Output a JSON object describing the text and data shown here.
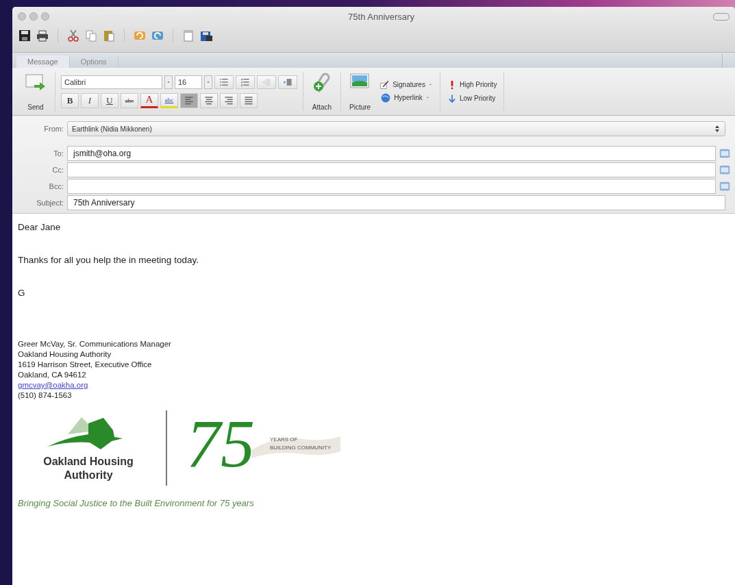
{
  "window": {
    "title": "75th Anniversary"
  },
  "tabs": [
    {
      "label": "Message",
      "selected": true
    },
    {
      "label": "Options",
      "selected": false
    }
  ],
  "ribbon": {
    "send": "Send",
    "font": "Calibri",
    "size": "16",
    "bold": "B",
    "italic": "I",
    "underline": "U",
    "strike": "abc",
    "font_color": "A",
    "highlight": "abc",
    "alignment": [
      {
        "selected": true
      },
      {
        "selected": false
      },
      {
        "selected": false
      },
      {
        "selected": false
      }
    ],
    "attach": "Attach",
    "picture": "Picture",
    "signatures": "Signatures",
    "hyperlink": "Hyperlink",
    "high_priority": "High Priority",
    "low_priority": "Low Priority"
  },
  "header": {
    "from_label": "From:",
    "from": "Earthlink (Nidia Mikkonen)",
    "fields": [
      {
        "label": "To:",
        "value": "jsmith@oha.org"
      },
      {
        "label": "Cc:"
      },
      {
        "label": "Bcc:"
      },
      {
        "label": "Subject:",
        "value": "75th Anniversary",
        "kind": "subject"
      }
    ]
  },
  "body": {
    "paragraphs": [
      "Dear Jane",
      "Thanks for all you help the in meeting today.",
      "G"
    ],
    "signature": [
      "Greer McVay, Sr. Communications Manager",
      "Oakland Housing Authority",
      "1619 Harrison Street, Executive Office",
      "Oakland, CA 94612"
    ],
    "email_link": "gmcvay@oakha.org",
    "phone": "(510) 874-1563",
    "logo": {
      "name_line_1": "Oakland Housing",
      "name_line_2": "Authority",
      "number": "75",
      "ribbon_1": "YEARS OF",
      "ribbon_2": "BUILDING COMMUNITY"
    },
    "tagline": "Bringing Social Justice to the Built Environment for 75 years"
  }
}
